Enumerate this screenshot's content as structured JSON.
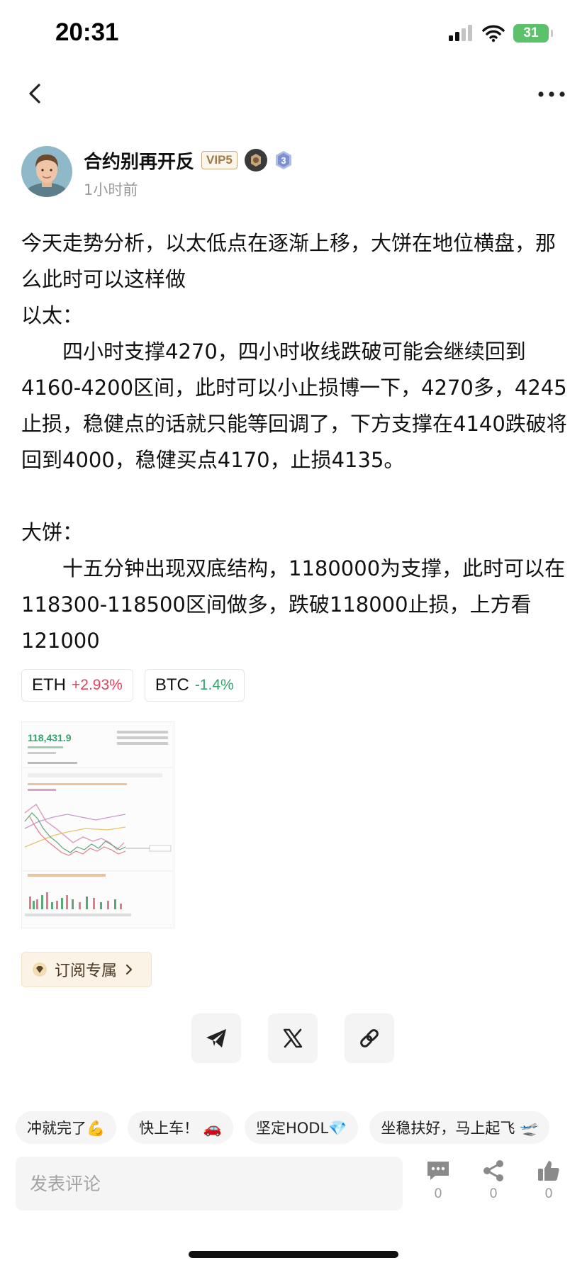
{
  "status_bar": {
    "time": "20:31",
    "battery": "31"
  },
  "author": {
    "name": "合约别再开反",
    "vip": "VIP5",
    "level": "3",
    "time": "1小时前"
  },
  "post": {
    "line1": "今天走势分析，以太低点在逐渐上移，大饼在地位横盘，那么此时可以这样做",
    "eth_heading": "以太：",
    "eth_body": "四小时支撑4270，四小时收线跌破可能会继续回到4160-4200区间，此时可以小止损博一下，4270多，4245止损，稳健点的话就只能等回调了，下方支撑在4140跌破将回到4000，稳健买点4170，止损4135。",
    "btc_heading": "大饼：",
    "btc_body": "十五分钟出现双底结构，1180000为支撑，此时可以在118300-118500区间做多，跌破118000止损，上方看121000"
  },
  "tickers": [
    {
      "symbol": "ETH",
      "change": "+2.93%",
      "color": "#e0435b"
    },
    {
      "symbol": "BTC",
      "change": "-1.4%",
      "color": "#2ea66a"
    }
  ],
  "thumbnail": {
    "price": "118,431.9"
  },
  "subscribe": {
    "label": "订阅专属"
  },
  "quick_replies": [
    "冲就完了💪",
    "快上车！ 🚗",
    "坚定HODL💎",
    "坐稳扶好，马上起飞 🛫"
  ],
  "comment": {
    "placeholder": "发表评论"
  },
  "actions": {
    "comments": "0",
    "shares": "0",
    "likes": "0"
  },
  "icons": {
    "back": "chevron-left-icon",
    "more": "more-horizontal-icon",
    "telegram": "telegram-icon",
    "x": "x-logo-icon",
    "link": "link-icon",
    "comment": "comment-icon",
    "share": "share-icon",
    "like": "thumbs-up-icon"
  }
}
